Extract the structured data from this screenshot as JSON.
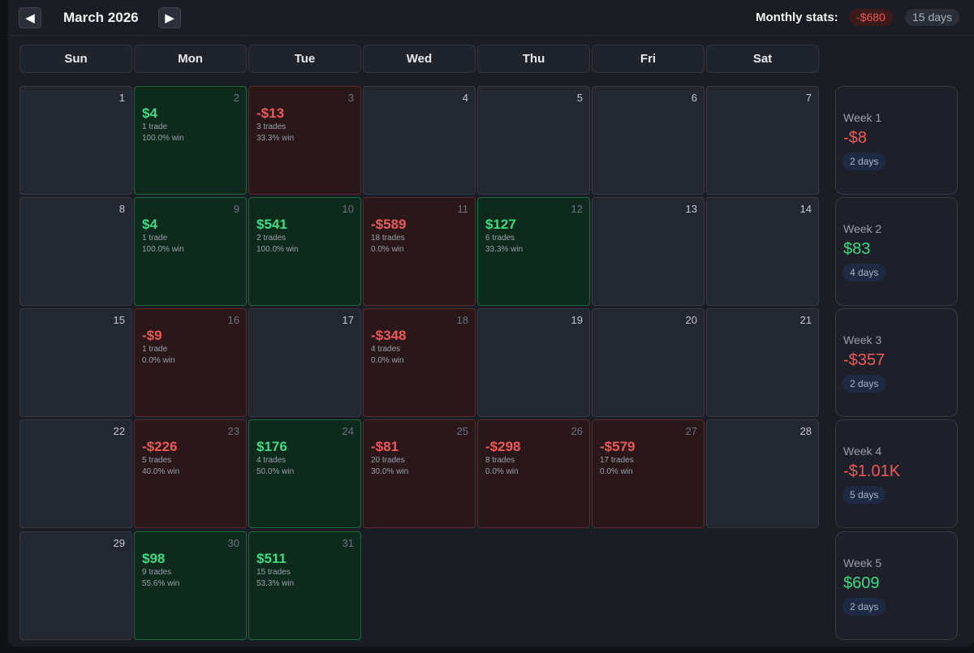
{
  "header": {
    "prev_label": "◀",
    "next_label": "▶",
    "month_title": "March 2026",
    "stats_label": "Monthly stats:",
    "monthly_pnl": "-$680",
    "monthly_days": "15 days"
  },
  "weekdays": [
    "Sun",
    "Mon",
    "Tue",
    "Wed",
    "Thu",
    "Fri",
    "Sat"
  ],
  "weeks": [
    {
      "label": "Week 1",
      "pnl": "-$8",
      "days": "2 days",
      "status": "neg",
      "cells": [
        {
          "day": "1"
        },
        {
          "day": "2",
          "pnl": "$4",
          "trades": "1 trade",
          "win": "100.0% win",
          "status": "pos"
        },
        {
          "day": "3",
          "pnl": "-$13",
          "trades": "3 trades",
          "win": "33.3% win",
          "status": "neg"
        },
        {
          "day": "4"
        },
        {
          "day": "5"
        },
        {
          "day": "6"
        },
        {
          "day": "7"
        }
      ]
    },
    {
      "label": "Week 2",
      "pnl": "$83",
      "days": "4 days",
      "status": "pos",
      "cells": [
        {
          "day": "8"
        },
        {
          "day": "9",
          "pnl": "$4",
          "trades": "1 trade",
          "win": "100.0% win",
          "status": "pos"
        },
        {
          "day": "10",
          "pnl": "$541",
          "trades": "2 trades",
          "win": "100.0% win",
          "status": "pos"
        },
        {
          "day": "11",
          "pnl": "-$589",
          "trades": "18 trades",
          "win": "0.0% win",
          "status": "neg"
        },
        {
          "day": "12",
          "pnl": "$127",
          "trades": "6 trades",
          "win": "33.3% win",
          "status": "pos"
        },
        {
          "day": "13"
        },
        {
          "day": "14"
        }
      ]
    },
    {
      "label": "Week 3",
      "pnl": "-$357",
      "days": "2 days",
      "status": "neg",
      "cells": [
        {
          "day": "15"
        },
        {
          "day": "16",
          "pnl": "-$9",
          "trades": "1 trade",
          "win": "0.0% win",
          "status": "neg"
        },
        {
          "day": "17"
        },
        {
          "day": "18",
          "pnl": "-$348",
          "trades": "4 trades",
          "win": "0.0% win",
          "status": "neg"
        },
        {
          "day": "19"
        },
        {
          "day": "20"
        },
        {
          "day": "21"
        }
      ]
    },
    {
      "label": "Week 4",
      "pnl": "-$1.01K",
      "days": "5 days",
      "status": "neg",
      "cells": [
        {
          "day": "22"
        },
        {
          "day": "23",
          "pnl": "-$226",
          "trades": "5 trades",
          "win": "40.0% win",
          "status": "neg"
        },
        {
          "day": "24",
          "pnl": "$176",
          "trades": "4 trades",
          "win": "50.0% win",
          "status": "pos"
        },
        {
          "day": "25",
          "pnl": "-$81",
          "trades": "20 trades",
          "win": "30.0% win",
          "status": "neg"
        },
        {
          "day": "26",
          "pnl": "-$298",
          "trades": "8 trades",
          "win": "0.0% win",
          "status": "neg"
        },
        {
          "day": "27",
          "pnl": "-$579",
          "trades": "17 trades",
          "win": "0.0% win",
          "status": "neg"
        },
        {
          "day": "28"
        }
      ]
    },
    {
      "label": "Week 5",
      "pnl": "$609",
      "days": "2 days",
      "status": "pos",
      "cells": [
        {
          "day": "29"
        },
        {
          "day": "30",
          "pnl": "$98",
          "trades": "9 trades",
          "win": "55.6% win",
          "status": "pos"
        },
        {
          "day": "31",
          "pnl": "$511",
          "trades": "15 trades",
          "win": "53.3% win",
          "status": "pos"
        }
      ]
    }
  ]
}
